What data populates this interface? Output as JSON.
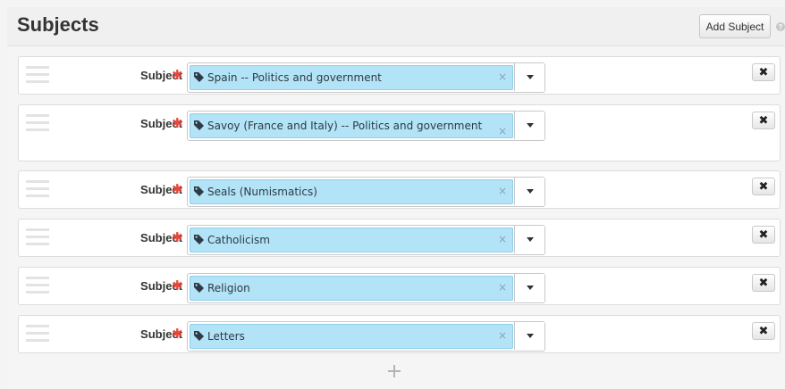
{
  "header": {
    "title": "Subjects",
    "add_button_label": "Add Subject",
    "help_icon": "?"
  },
  "field_label": "Subject",
  "required_marker": "✱",
  "remove_token_glyph": "×",
  "remove_row_glyph": "✖",
  "rows": [
    {
      "value": "Spain -- Politics and government"
    },
    {
      "value": "Savoy (France and Italy) -- Politics and government"
    },
    {
      "value": "Seals (Numismatics)"
    },
    {
      "value": "Catholicism"
    },
    {
      "value": "Religion"
    },
    {
      "value": "Letters"
    }
  ],
  "icons": {
    "drag": "drag-handle-icon",
    "tag": "tag-icon",
    "dropdown": "caret-down-icon",
    "remove": "close-icon",
    "add": "plus-icon"
  },
  "colors": {
    "token_bg": "#b2e3f7",
    "required": "#e8473b"
  }
}
